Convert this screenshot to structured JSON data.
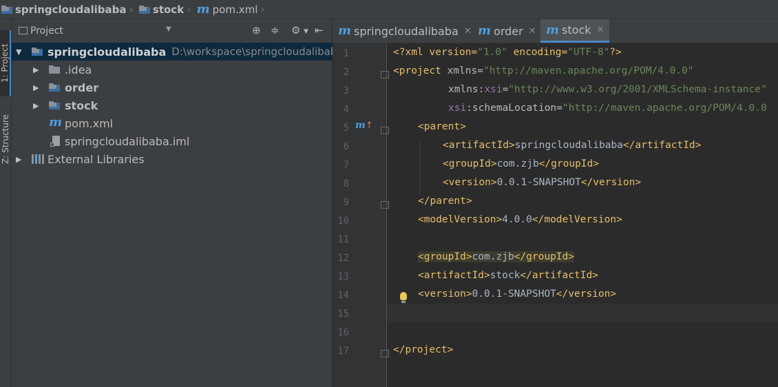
{
  "breadcrumb": {
    "items": [
      {
        "label": "springcloudalibaba",
        "icon": "module-folder-icon"
      },
      {
        "label": "stock",
        "icon": "module-folder-icon"
      },
      {
        "label": "pom.xml",
        "icon": "maven-icon"
      }
    ]
  },
  "left_strip": {
    "project_tab": "1: Project",
    "structure_tab": "Z: Structure"
  },
  "project_panel": {
    "title": "Project",
    "tree": [
      {
        "label": "springcloudalibaba",
        "path": "D:\\workspace\\springcloudalibaba"
      },
      {
        "label": ".idea"
      },
      {
        "label": "order"
      },
      {
        "label": "stock"
      },
      {
        "label": "pom.xml"
      },
      {
        "label": "springcloudalibaba.iml"
      },
      {
        "label": "External Libraries"
      }
    ]
  },
  "editor": {
    "tabs": [
      {
        "label": "springcloudalibaba",
        "active": false
      },
      {
        "label": "order",
        "active": false
      },
      {
        "label": "stock",
        "active": true
      }
    ],
    "line_numbers": [
      "1",
      "2",
      "3",
      "4",
      "5",
      "6",
      "7",
      "8",
      "9",
      "10",
      "11",
      "12",
      "13",
      "14",
      "15",
      "16",
      "17"
    ],
    "code": {
      "l1_a": "<?xml version=",
      "l1_b": "\"1.0\"",
      "l1_c": " encoding=",
      "l1_d": "\"UTF-8\"",
      "l1_e": "?>",
      "l2_a": "<project ",
      "l2_b": "xmlns=",
      "l2_c": "\"http://maven.apache.org/POM/4.0.0\"",
      "l3_a": "xmlns:",
      "l3_b": "xsi",
      "l3_c": "=",
      "l3_d": "\"http://www.w3.org/2001/XMLSchema-instance\"",
      "l4_a": "xsi",
      "l4_b": ":schemaLocation=",
      "l4_c": "\"http://maven.apache.org/POM/4.0.0",
      "l5": "<parent>",
      "l6_a": "<artifactId>",
      "l6_b": "springcloudalibaba",
      "l6_c": "</artifactId>",
      "l7_a": "<groupId>",
      "l7_b": "com.zjb",
      "l7_c": "</groupId>",
      "l8_a": "<version>",
      "l8_b": "0.0.1-SNAPSHOT",
      "l8_c": "</version>",
      "l9": "</parent>",
      "l10_a": "<modelVersion>",
      "l10_b": "4.0.0",
      "l10_c": "</modelVersion>",
      "l12_a": "<groupId>",
      "l12_b": "com.zjb",
      "l12_c": "</groupId>",
      "l13_a": "<artifactId>",
      "l13_b": "stock",
      "l13_c": "</artifactId>",
      "l14_a": "<version>",
      "l14_b": "0.0.1-SNAPSHOT",
      "l14_c": "</version>",
      "l17": "</project>"
    }
  },
  "colors": {
    "tag": "#e8bf6a",
    "string": "#6a8759",
    "namespace": "#9876aa",
    "maven_icon": "#4f9fe0",
    "selection": "#0d293e",
    "accent": "#4a88c7"
  }
}
